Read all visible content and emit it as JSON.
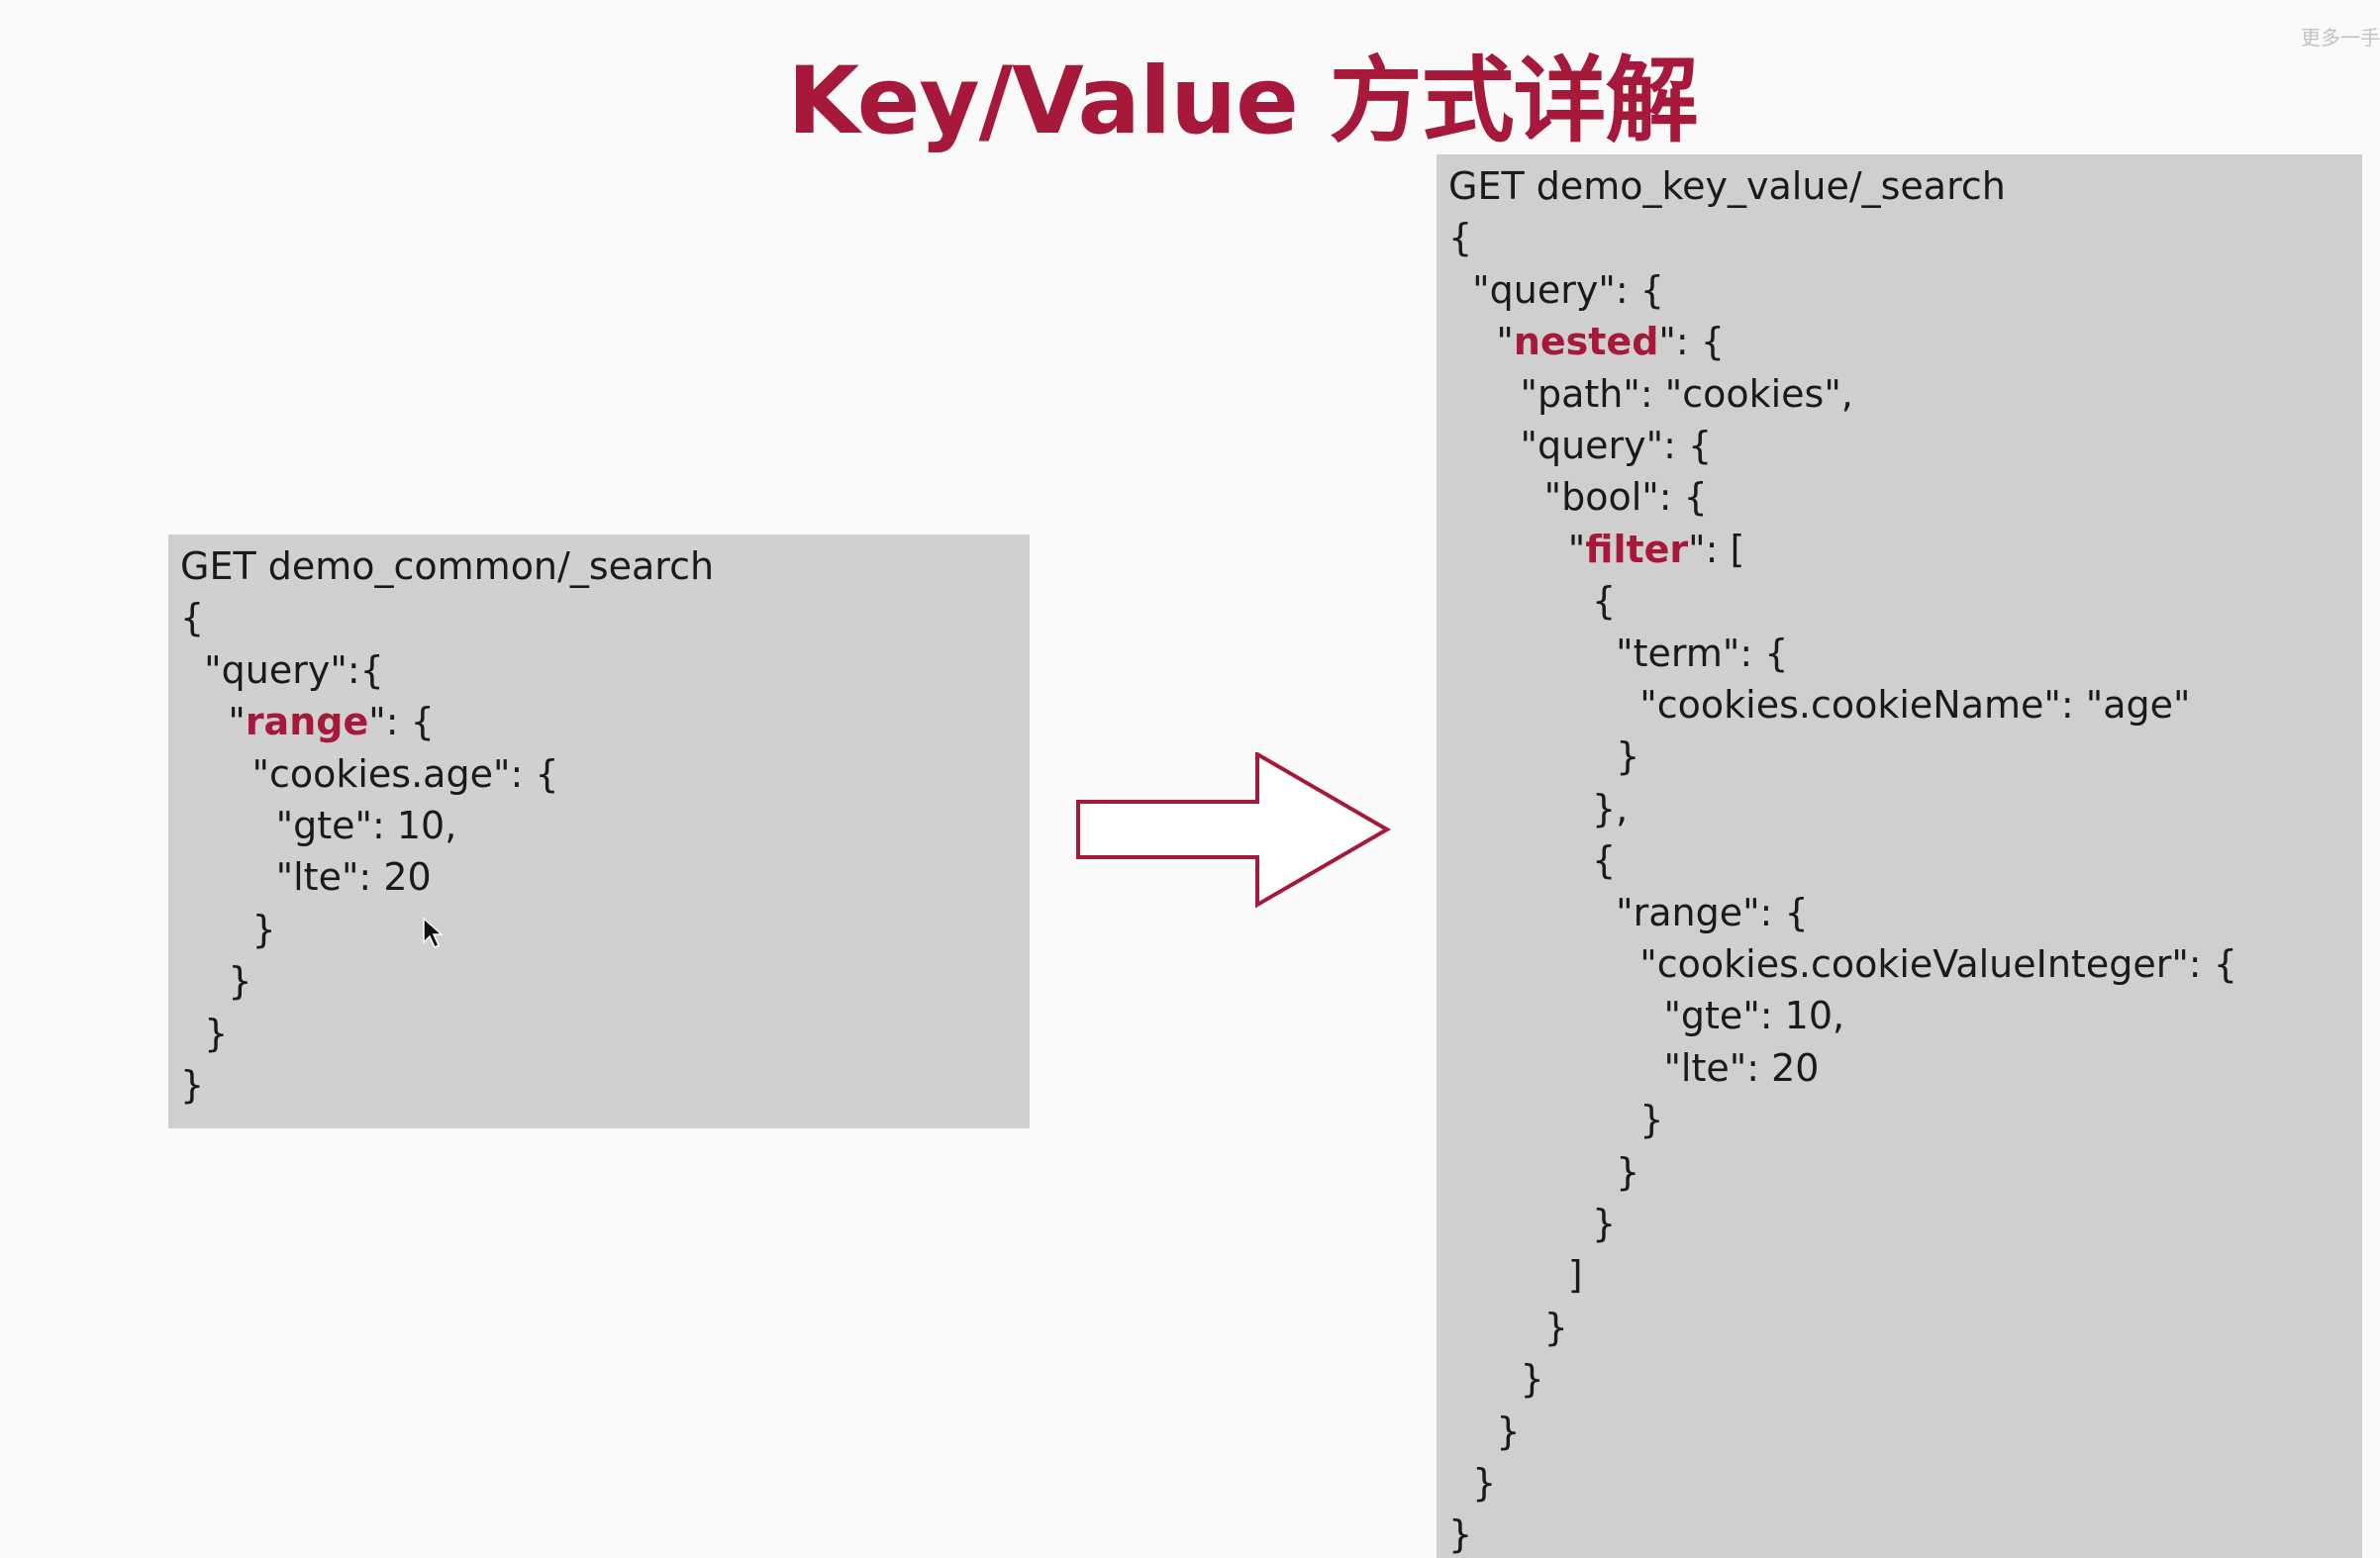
{
  "slide": {
    "title": "Key/Value 方式详解",
    "corner_note": "更多一手"
  },
  "left_panel": {
    "lines": [
      {
        "indent": "",
        "pre": "GET demo_common/_search",
        "hl": "",
        "post": ""
      },
      {
        "indent": "",
        "pre": "{",
        "hl": "",
        "post": ""
      },
      {
        "indent": "  ",
        "pre": "\"query\":{",
        "hl": "",
        "post": ""
      },
      {
        "indent": "    ",
        "pre": "\"",
        "hl": "range",
        "post": "\": {"
      },
      {
        "indent": "      ",
        "pre": "\"cookies.age\": {",
        "hl": "",
        "post": ""
      },
      {
        "indent": "        ",
        "pre": "\"gte\": 10,",
        "hl": "",
        "post": ""
      },
      {
        "indent": "        ",
        "pre": "\"lte\": 20",
        "hl": "",
        "post": ""
      },
      {
        "indent": "      ",
        "pre": "}",
        "hl": "",
        "post": ""
      },
      {
        "indent": "    ",
        "pre": "}",
        "hl": "",
        "post": ""
      },
      {
        "indent": "  ",
        "pre": "}",
        "hl": "",
        "post": ""
      },
      {
        "indent": "",
        "pre": "}",
        "hl": "",
        "post": ""
      }
    ]
  },
  "right_panel": {
    "lines": [
      {
        "indent": "",
        "pre": "GET demo_key_value/_search",
        "hl": "",
        "post": ""
      },
      {
        "indent": "",
        "pre": "{",
        "hl": "",
        "post": ""
      },
      {
        "indent": "  ",
        "pre": "\"query\": {",
        "hl": "",
        "post": ""
      },
      {
        "indent": "    ",
        "pre": "\"",
        "hl": "nested",
        "post": "\": {"
      },
      {
        "indent": "      ",
        "pre": "\"path\": \"cookies\",",
        "hl": "",
        "post": ""
      },
      {
        "indent": "      ",
        "pre": "\"query\": {",
        "hl": "",
        "post": ""
      },
      {
        "indent": "        ",
        "pre": "\"bool\": {",
        "hl": "",
        "post": ""
      },
      {
        "indent": "          ",
        "pre": "\"",
        "hl": "filter",
        "post": "\": ["
      },
      {
        "indent": "            ",
        "pre": "{",
        "hl": "",
        "post": ""
      },
      {
        "indent": "              ",
        "pre": "\"term\": {",
        "hl": "",
        "post": ""
      },
      {
        "indent": "                ",
        "pre": "\"cookies.cookieName\": \"age\"",
        "hl": "",
        "post": ""
      },
      {
        "indent": "              ",
        "pre": "}",
        "hl": "",
        "post": ""
      },
      {
        "indent": "            ",
        "pre": "},",
        "hl": "",
        "post": ""
      },
      {
        "indent": "            ",
        "pre": "{",
        "hl": "",
        "post": ""
      },
      {
        "indent": "              ",
        "pre": "\"range\": {",
        "hl": "",
        "post": ""
      },
      {
        "indent": "                ",
        "pre": "\"cookies.cookieValueInteger\": {",
        "hl": "",
        "post": ""
      },
      {
        "indent": "                  ",
        "pre": "\"gte\": 10,",
        "hl": "",
        "post": ""
      },
      {
        "indent": "                  ",
        "pre": "\"lte\": 20",
        "hl": "",
        "post": ""
      },
      {
        "indent": "                ",
        "pre": "}",
        "hl": "",
        "post": ""
      },
      {
        "indent": "              ",
        "pre": "}",
        "hl": "",
        "post": ""
      },
      {
        "indent": "            ",
        "pre": "}",
        "hl": "",
        "post": ""
      },
      {
        "indent": "          ",
        "pre": "]",
        "hl": "",
        "post": ""
      },
      {
        "indent": "        ",
        "pre": "}",
        "hl": "",
        "post": ""
      },
      {
        "indent": "      ",
        "pre": "}",
        "hl": "",
        "post": ""
      },
      {
        "indent": "    ",
        "pre": "}",
        "hl": "",
        "post": ""
      },
      {
        "indent": "  ",
        "pre": "}",
        "hl": "",
        "post": ""
      },
      {
        "indent": "",
        "pre": "}",
        "hl": "",
        "post": ""
      }
    ]
  },
  "colors": {
    "accent": "#a6193a",
    "panel_bg": "#d0d0d0",
    "arrow_stroke": "#a6193a"
  },
  "icons": {
    "arrow": "right-arrow-icon",
    "cursor": "mouse-pointer-icon"
  }
}
